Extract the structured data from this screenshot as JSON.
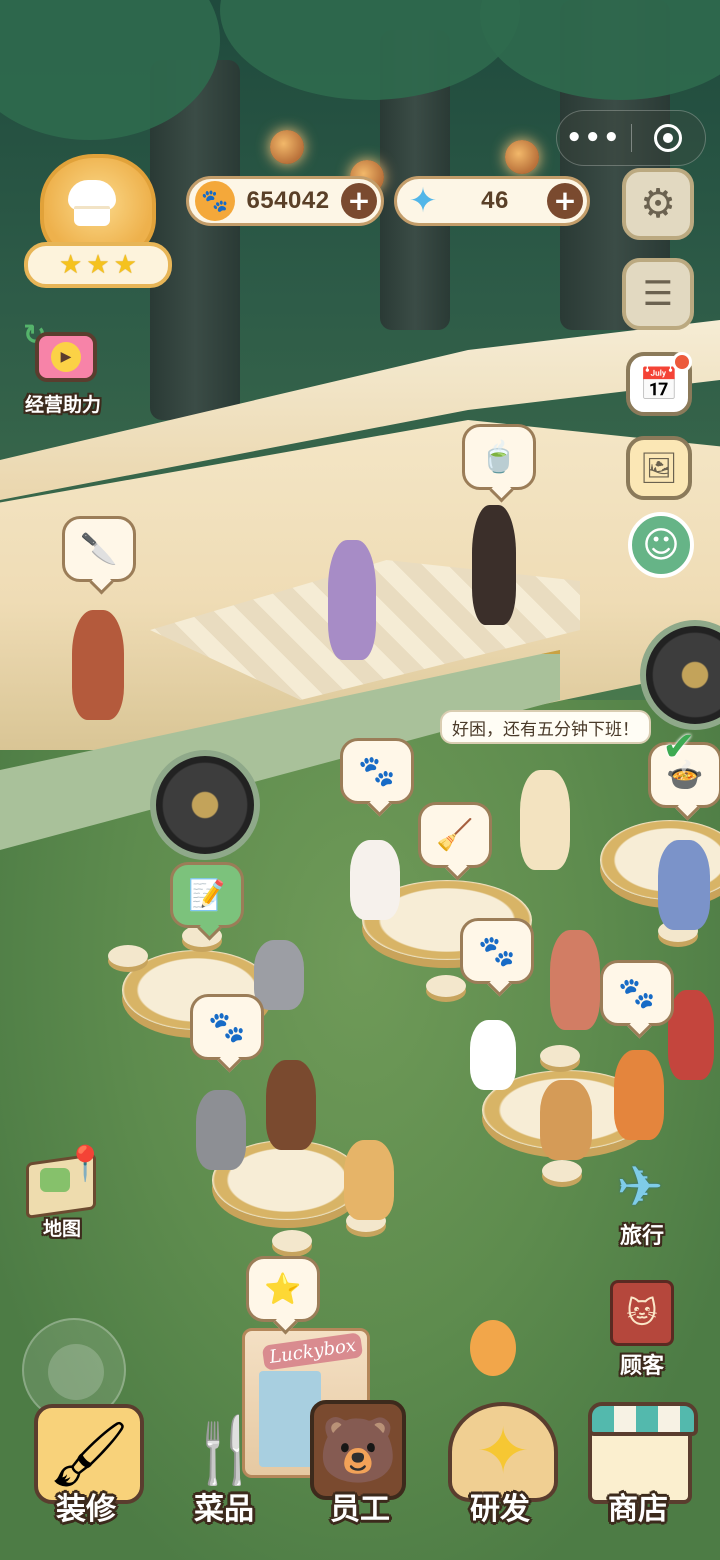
{
  "hud": {
    "rating_stars": 3,
    "paws": {
      "value": "654042",
      "icon": "paw-coin-icon"
    },
    "gems": {
      "value": "46",
      "icon": "gem-icon"
    }
  },
  "left_menu": {
    "boost_label": "经营助力",
    "map_label": "地图"
  },
  "right_menu": {
    "travel_label": "旅行",
    "customers_label": "顾客"
  },
  "bottom_nav": [
    {
      "label": "装修",
      "icon": "paint-roller-icon"
    },
    {
      "label": "菜品",
      "icon": "fork-spoon-icon"
    },
    {
      "label": "员工",
      "icon": "staff-badge-icon"
    },
    {
      "label": "研发",
      "icon": "cooking-pot-icon"
    },
    {
      "label": "商店",
      "icon": "shop-icon"
    }
  ],
  "scene": {
    "speech_text": "好困，还有五分钟下班！",
    "lucky_box_sign": "Luckybox"
  },
  "colors": {
    "accent_gold": "#eeb14c",
    "paw_orange": "#f4a83a",
    "gem_blue": "#52b6e8",
    "plus_brown": "#7a4a2f",
    "grass_green": "#5e8c4e"
  }
}
